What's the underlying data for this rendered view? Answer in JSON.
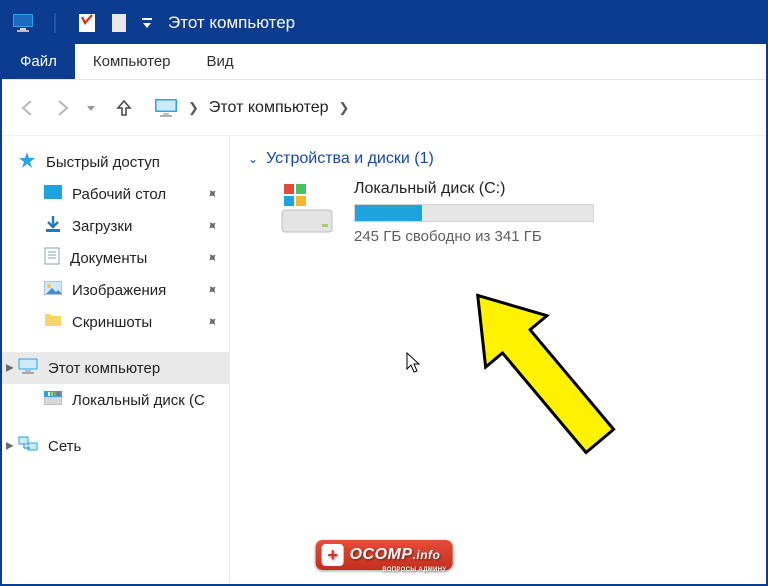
{
  "window": {
    "title": "Этот компьютер"
  },
  "ribbon": {
    "tabs": {
      "file": "Файл",
      "computer": "Компьютер",
      "view": "Вид"
    }
  },
  "breadcrumb": {
    "root": "Этот компьютер"
  },
  "sidebar": {
    "quick_access": "Быстрый доступ",
    "desktop": "Рабочий стол",
    "downloads": "Загрузки",
    "documents": "Документы",
    "pictures": "Изображения",
    "screenshots": "Скриншоты",
    "this_pc": "Этот компьютер",
    "local_disk": "Локальный диск (C",
    "network": "Сеть"
  },
  "content": {
    "group_header": "Устройства и диски (1)",
    "drive": {
      "name": "Локальный диск (C:)",
      "free_text": "245 ГБ свободно из 341 ГБ",
      "fill_percent": 28
    }
  },
  "watermark": {
    "text": "OCOMP",
    "suffix": ".info",
    "sub": "ВОПРОСЫ АДМИНУ"
  }
}
